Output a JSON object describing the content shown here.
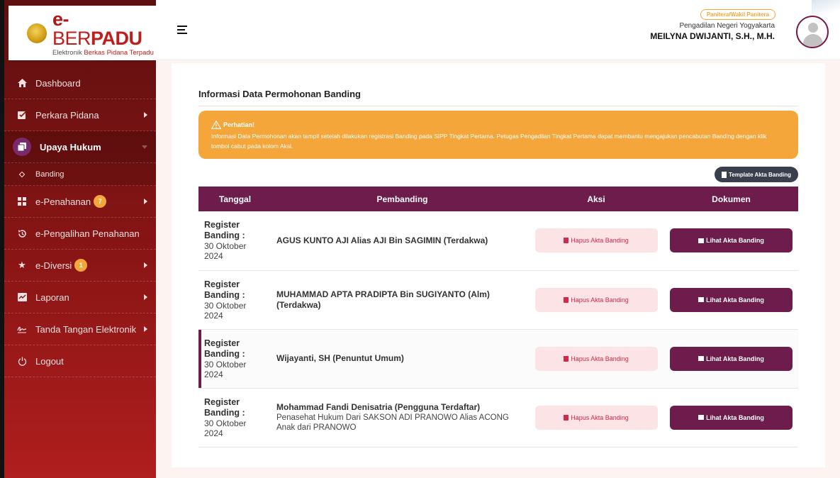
{
  "app": {
    "logo_e": "e-",
    "logo_ber": "BER",
    "logo_padu": "PADU",
    "logo_sub_prefix": "Elektronik ",
    "logo_sub_hl": "Berkas Pidana Terpadu"
  },
  "header": {
    "role": "Panitera/Wakil Panitera",
    "court": "Pengadilan Negeri Yogyakarta",
    "user": "MEILYNA DWIJANTI, S.H., M.H."
  },
  "sidebar": {
    "items": [
      {
        "label": "Dashboard"
      },
      {
        "label": "Perkara Pidana"
      },
      {
        "label": "Upaya Hukum"
      },
      {
        "label": "Banding"
      },
      {
        "label": "e-Penahanan",
        "badge": "7"
      },
      {
        "label": "e-Pengalihan Penahanan"
      },
      {
        "label": "e-Diversi",
        "badge": "1"
      },
      {
        "label": "Laporan"
      },
      {
        "label": "Tanda Tangan Elektronik"
      },
      {
        "label": "Logout"
      }
    ]
  },
  "main": {
    "title": "Informasi Data Permohonan Banding",
    "alert_title": "Perhatian!",
    "alert_text": "Informasi Data Permohonan akan tampil setelah dilakukan registrasi Banding pada SIPP Tingkat Pertama. Petugas Pengadilan Tingkat Pertama dapat membantu mengajukan pencabutan Banding dengan klik tombol cabut pada kolom Aksi.",
    "template_button": "Template Akta Banding",
    "columns": [
      "Tanggal",
      "Pembanding",
      "Aksi",
      "Dokumen"
    ],
    "rows": [
      {
        "reg_label": "Register Banding :",
        "date": "30 Oktober 2024",
        "name": "AGUS KUNTO AJI Alias AJI Bin SAGIMIN (Terdakwa)",
        "desc": "",
        "hapus": "Hapus Akta Banding",
        "lihat": "Lihat Akta Banding"
      },
      {
        "reg_label": "Register Banding :",
        "date": "30 Oktober 2024",
        "name": "MUHAMMAD APTA PRADIPTA Bin SUGIYANTO (Alm) (Terdakwa)",
        "desc": "",
        "hapus": "Hapus Akta Banding",
        "lihat": "Lihat Akta Banding"
      },
      {
        "reg_label": "Register Banding :",
        "date": "30 Oktober 2024",
        "name": "Wijayanti, SH (Penuntut Umum)",
        "desc": "",
        "hapus": "Hapus Akta Banding",
        "lihat": "Lihat Akta Banding"
      },
      {
        "reg_label": "Register Banding :",
        "date": "30 Oktober 2024",
        "name": "Mohammad Fandi Denisatria (Pengguna Terdaftar)",
        "desc": "Penasehat Hukum Dari SAKSON ADI PRANOWO Alias ACONG Anak dari PRANOWO",
        "hapus": "Hapus Akta Banding",
        "lihat": "Lihat Akta Banding"
      }
    ]
  },
  "colors": {
    "primary": "#6d1c4c",
    "sidebar": "#8b1515",
    "alert": "#f4a63a",
    "danger": "#d42a4a"
  }
}
